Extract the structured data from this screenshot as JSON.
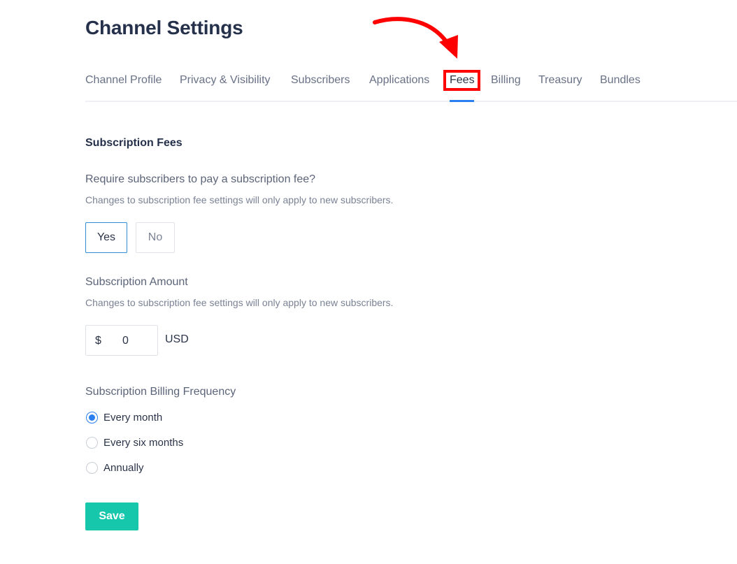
{
  "page": {
    "title": "Channel Settings"
  },
  "tabs": [
    {
      "label": "Channel Profile"
    },
    {
      "label": "Privacy & Visibility"
    },
    {
      "label": "Subscribers"
    },
    {
      "label": "Applications"
    },
    {
      "label": "Fees",
      "active": true
    },
    {
      "label": "Billing"
    },
    {
      "label": "Treasury"
    },
    {
      "label": "Bundles"
    }
  ],
  "annotation": {
    "highlight_color": "#ff0000",
    "highlighted_tab": "Fees"
  },
  "subscription_fees": {
    "section_title": "Subscription Fees",
    "require_fee": {
      "question": "Require subscribers to pay a subscription fee?",
      "help": "Changes to subscription fee settings will only apply to new subscribers.",
      "yes_label": "Yes",
      "no_label": "No",
      "selected": "Yes"
    },
    "amount": {
      "label": "Subscription Amount",
      "help": "Changes to subscription fee settings will only apply to new subscribers.",
      "currency_symbol": "$",
      "value": "0",
      "currency_code": "USD"
    },
    "frequency": {
      "label": "Subscription Billing Frequency",
      "options": [
        {
          "label": "Every month",
          "checked": true
        },
        {
          "label": "Every six months",
          "checked": false
        },
        {
          "label": "Annually",
          "checked": false
        }
      ]
    }
  },
  "actions": {
    "save_label": "Save"
  },
  "colors": {
    "accent_blue": "#2b7ff0",
    "save_button": "#17c7ac",
    "title_text": "#25304a"
  }
}
